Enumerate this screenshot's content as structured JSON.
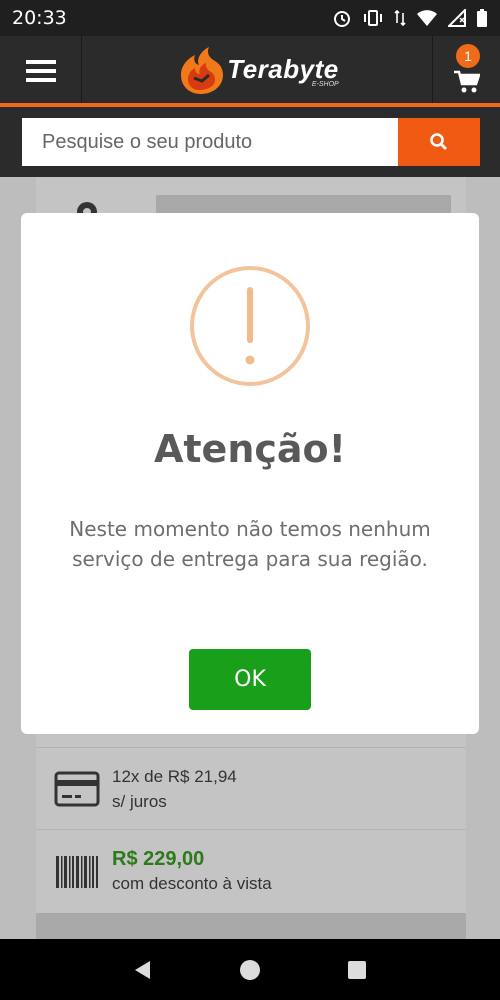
{
  "status_bar": {
    "time": "20:33",
    "icons": [
      "alarm-icon",
      "vibrate-icon",
      "data-arrows-icon",
      "wifi-icon",
      "signal-icon",
      "battery-icon"
    ]
  },
  "header": {
    "logo_text": "Terabyte",
    "logo_sub": "E-SHOP",
    "cart_count": "1"
  },
  "search": {
    "placeholder": "Pesquise o seu produto"
  },
  "background": {
    "installments": {
      "line1": "12x de R$ 21,94",
      "line2": "s/ juros"
    },
    "cash": {
      "price": "R$ 229,00",
      "note": "com desconto à vista"
    }
  },
  "modal": {
    "title": "Atenção!",
    "message": "Neste momento não temos nenhum serviço de entrega para sua região.",
    "ok_label": "OK"
  },
  "colors": {
    "accent": "#ef6a1a",
    "header_bg": "#2b2b2b",
    "ok_green": "#1a9f1a",
    "warning": "#f2c49b",
    "price_green": "#2c7a1a"
  }
}
